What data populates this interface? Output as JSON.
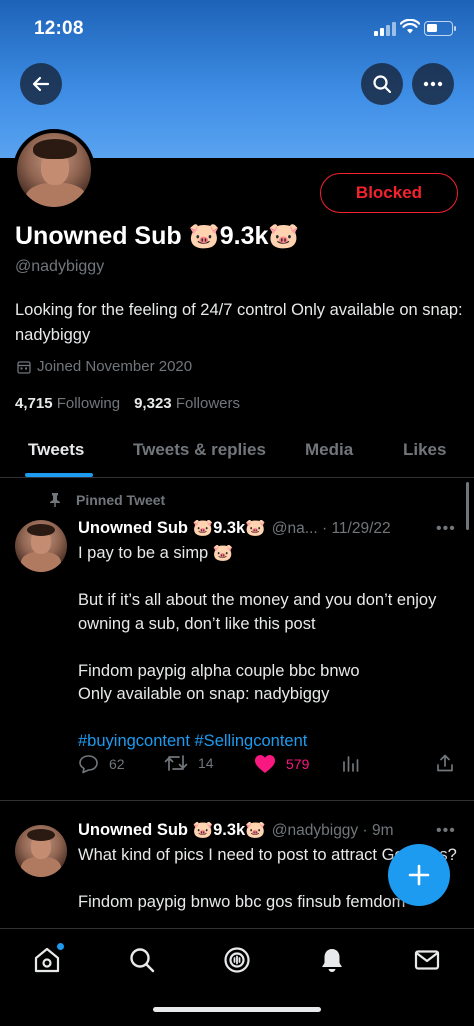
{
  "status_bar": {
    "time": "12:08"
  },
  "profile": {
    "display_name": "Unowned Sub 🐷9.3k🐷",
    "handle": "@nadybiggy",
    "blocked_label": "Blocked",
    "bio": "Looking for the feeling of 24/7 control Only available on snap: nadybiggy",
    "joined": "Joined November 2020",
    "following_count": "4,715",
    "following_label": "Following",
    "followers_count": "9,323",
    "followers_label": "Followers"
  },
  "tabs": [
    {
      "label": "Tweets",
      "active": true
    },
    {
      "label": "Tweets & replies",
      "active": false
    },
    {
      "label": "Media",
      "active": false
    },
    {
      "label": "Likes",
      "active": false
    }
  ],
  "tweets": [
    {
      "pinned_label": "Pinned Tweet",
      "name": "Unowned Sub 🐷9.3k🐷",
      "meta": "@na... · 11/29/22",
      "body": "I pay to be a simp 🐷\n\nBut if it’s all about the money and you don’t enjoy owning a sub, don’t like this post\n\nFindom paypig alpha couple bbc bnwo\nOnly available on snap: nadybiggy\n\n",
      "hashtags": "#buyingcontent #Sellingcontent",
      "replies": "62",
      "retweets": "14",
      "likes": "579"
    },
    {
      "name": "Unowned Sub 🐷9.3k🐷",
      "meta": "@nadybiggy · 9m",
      "body": "What kind of pics I need to post to attract Goddess?\n\nFindom paypig bnwo bbc gos finsub femdom"
    }
  ],
  "colors": {
    "accent": "#1d9bf0",
    "blocked": "#f4212e",
    "like": "#f91880",
    "banner": "#3f8ee6"
  },
  "icons": {
    "back": "arrow-left-icon",
    "search": "search-icon",
    "more": "more-dots-icon",
    "calendar": "calendar-icon",
    "pin": "pin-icon",
    "reply": "reply-icon",
    "retweet": "retweet-icon",
    "like": "heart-icon",
    "views": "views-icon",
    "share": "share-icon",
    "compose": "plus-icon",
    "home": "home-icon",
    "explore": "search-icon",
    "spaces": "spaces-icon",
    "notifications": "bell-icon",
    "messages": "mail-icon"
  }
}
